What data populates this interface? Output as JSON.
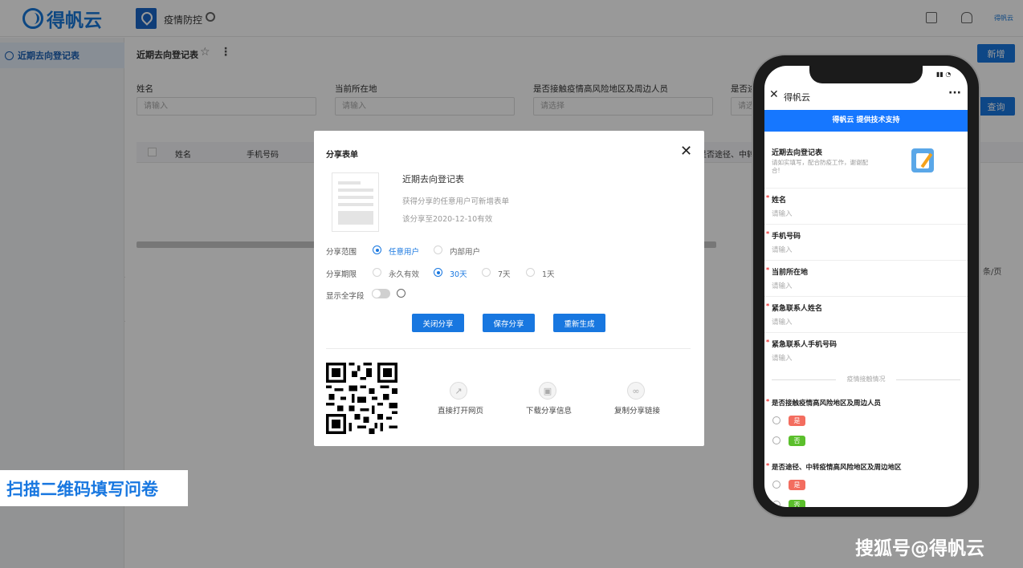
{
  "app": {
    "logo_text": "得帆云",
    "module_name": "疫情防控",
    "user_short": "得帆云"
  },
  "sidebar": {
    "items": [
      {
        "label": "近期去向登记表"
      }
    ]
  },
  "main": {
    "form_title": "近期去向登记表",
    "new_button": "新增",
    "query_button": "查询",
    "filters": [
      {
        "label": "姓名",
        "placeholder": "请输入"
      },
      {
        "label": "当前所在地",
        "placeholder": "请输入"
      },
      {
        "label": "是否接触疫情高风险地区及周边人员",
        "placeholder": "请选择"
      },
      {
        "label": "是否途",
        "placeholder": "请选"
      }
    ],
    "table_headers": [
      "姓名",
      "手机号码",
      "是否途径、中转"
    ],
    "pagination_tail": "条/页"
  },
  "modal": {
    "title": "分享表单",
    "form_name": "近期去向登记表",
    "desc1": "获得分享的任意用户可新增表单",
    "desc2": "该分享至2020-12-10有效",
    "scope_label": "分享范围",
    "scope_options": [
      "任意用户",
      "内部用户"
    ],
    "scope_selected": "任意用户",
    "period_label": "分享期限",
    "period_options": [
      "永久有效",
      "30天",
      "7天",
      "1天"
    ],
    "period_selected": "30天",
    "show_all_label": "显示全字段",
    "show_all_enabled": false,
    "buttons": [
      "关闭分享",
      "保存分享",
      "重新生成"
    ],
    "actions": [
      {
        "label": "直接打开网页",
        "icon": "external-link-icon"
      },
      {
        "label": "下载分享信息",
        "icon": "image-icon"
      },
      {
        "label": "复制分享链接",
        "icon": "link-icon"
      }
    ]
  },
  "banner": "扫描二维码填写问卷",
  "watermark": "搜狐号@得帆云",
  "phone": {
    "nav_title": "得帆云",
    "tech_support": "得帆云 提供技术支持",
    "form_title": "近期去向登记表",
    "form_desc": "请如实填写，配合防疫工作，谢谢配合!",
    "fields": [
      {
        "label": "姓名",
        "placeholder": "请输入"
      },
      {
        "label": "手机号码",
        "placeholder": "请输入"
      },
      {
        "label": "当前所在地",
        "placeholder": "请输入"
      },
      {
        "label": "紧急联系人姓名",
        "placeholder": "请输入"
      },
      {
        "label": "紧急联系人手机号码",
        "placeholder": "请输入"
      }
    ],
    "section": "疫情接触情况",
    "questions": [
      {
        "label": "是否接触疫情高风险地区及周边人员",
        "options": [
          "是",
          "否"
        ]
      },
      {
        "label": "是否途径、中转疫情高风险地区及周边地区",
        "options": [
          "是",
          "否"
        ]
      }
    ]
  },
  "colors": {
    "primary": "#1877e0",
    "tag_yes": "#f36d5f",
    "tag_no": "#5bbf2c"
  }
}
